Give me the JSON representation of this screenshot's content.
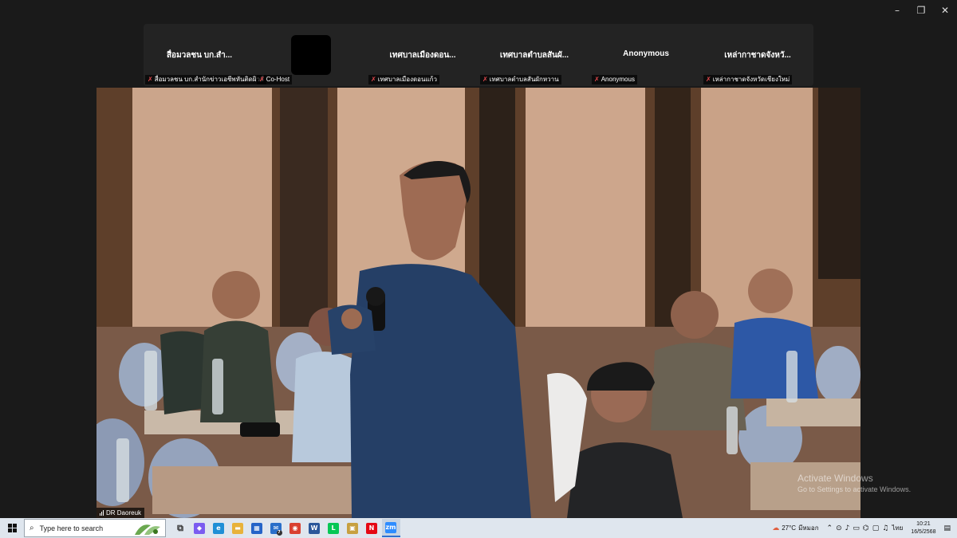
{
  "window_controls": {
    "minimize": "–",
    "restore": "❐",
    "close": "✕"
  },
  "participants": [
    {
      "name": "สื่อมวลชน บก.สำ...",
      "label": "สื่อมวลชน บก.สำนักข่าวเอชีพหันติดผิวส์",
      "black_avatar": false
    },
    {
      "name": "",
      "label": "Co-Host",
      "black_avatar": true
    },
    {
      "name": "เทศบาลเมืองดอน...",
      "label": "เทศบาลเมืองดอนแก้ว",
      "black_avatar": false
    },
    {
      "name": "เทศบาลตำบลสันผั...",
      "label": "เทศบาลตำบลสันผักหวาน",
      "black_avatar": false
    },
    {
      "name": "Anonymous",
      "label": "Anonymous",
      "black_avatar": false
    },
    {
      "name": "เหล่ากาชาดจังหวั...",
      "label": "เหล่ากาชาดจังหวัดเชียงใหม่",
      "black_avatar": false
    }
  ],
  "speaker": {
    "name": "DR Daoreuk"
  },
  "activation": {
    "title": "Activate Windows",
    "subtitle": "Go to Settings to activate Windows."
  },
  "taskbar": {
    "search_placeholder": "Type here to search",
    "apps": [
      {
        "icon": "task-view-icon",
        "glyph": "⧉",
        "color": "#333333"
      },
      {
        "icon": "copilot-icon",
        "glyph": "◆",
        "color": "#7b5cf0"
      },
      {
        "icon": "edge-icon",
        "glyph": "e",
        "color": "#1f8fd6"
      },
      {
        "icon": "file-explorer-icon",
        "glyph": "▬",
        "color": "#e8b23a"
      },
      {
        "icon": "store-icon",
        "glyph": "▦",
        "color": "#2564c8"
      },
      {
        "icon": "mail-icon",
        "glyph": "✉",
        "color": "#2a6fc9"
      },
      {
        "icon": "chrome-icon",
        "glyph": "◉",
        "color": "#d94030"
      },
      {
        "icon": "word-icon",
        "glyph": "W",
        "color": "#2b579a"
      },
      {
        "icon": "line-icon",
        "glyph": "L",
        "color": "#06c755"
      },
      {
        "icon": "photos-icon",
        "glyph": "▣",
        "color": "#c7a040"
      },
      {
        "icon": "netflix-icon",
        "glyph": "N",
        "color": "#e50914"
      },
      {
        "icon": "zoom-icon",
        "glyph": "zm",
        "color": "#2d8cff"
      }
    ],
    "mail_badge": "7",
    "weather": "27°C",
    "weather_desc": "มีหมอก",
    "language": "ไทย",
    "time": "10:21",
    "date": "16/5/2568"
  }
}
